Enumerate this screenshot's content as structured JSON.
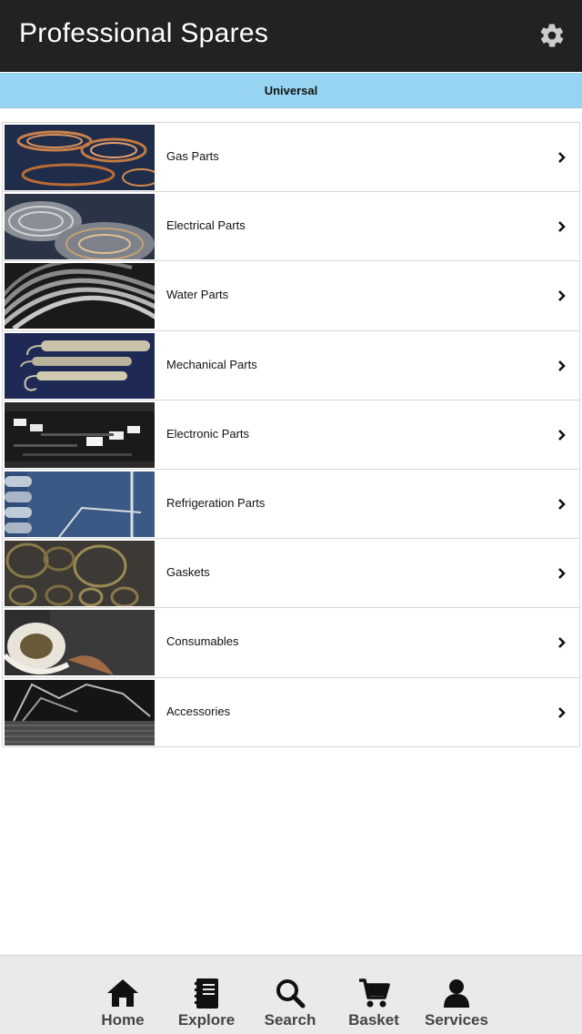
{
  "header": {
    "title": "Professional Spares",
    "settings_icon": "gear-icon"
  },
  "segment": {
    "label": "Universal"
  },
  "categories": [
    {
      "label": "Gas Parts"
    },
    {
      "label": "Electrical Parts"
    },
    {
      "label": "Water Parts"
    },
    {
      "label": "Mechanical Parts"
    },
    {
      "label": "Electronic Parts"
    },
    {
      "label": "Refrigeration Parts"
    },
    {
      "label": "Gaskets"
    },
    {
      "label": "Consumables"
    },
    {
      "label": "Accessories"
    }
  ],
  "tabbar": {
    "items": [
      {
        "label": "Home",
        "icon": "home-icon"
      },
      {
        "label": "Explore",
        "icon": "book-icon"
      },
      {
        "label": "Search",
        "icon": "search-icon"
      },
      {
        "label": "Basket",
        "icon": "cart-icon"
      },
      {
        "label": "Services",
        "icon": "user-icon"
      }
    ]
  },
  "colors": {
    "header_bg": "#222222",
    "segment_bg": "#97d4f1",
    "tabbar_bg": "#eaeaea"
  }
}
